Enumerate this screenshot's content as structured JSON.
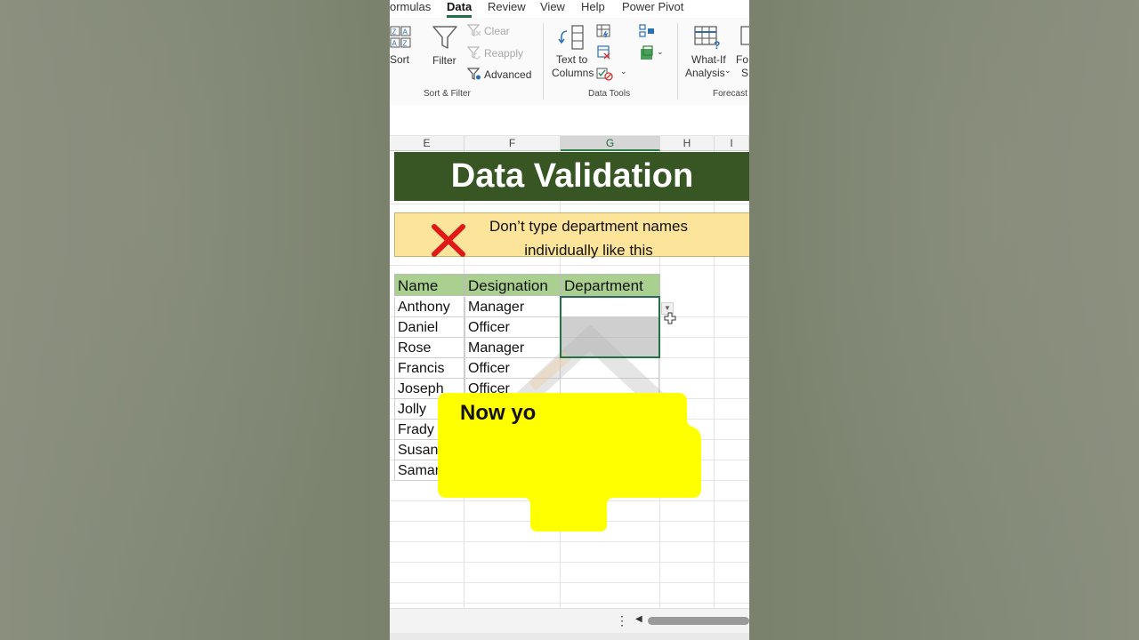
{
  "ribbon": {
    "tabs": [
      {
        "label": "ormulas"
      },
      {
        "label": "Data"
      },
      {
        "label": "Review"
      },
      {
        "label": "View"
      },
      {
        "label": "Help"
      },
      {
        "label": "Power Pivot"
      }
    ],
    "sort_filter": {
      "sort_label": "Sort",
      "filter_label": "Filter",
      "clear_label": "Clear",
      "reapply_label": "Reapply",
      "advanced_label": "Advanced",
      "group_label": "Sort & Filter"
    },
    "data_tools": {
      "text_to_columns_line1": "Text to",
      "text_to_columns_line2": "Columns",
      "group_label": "Data Tools"
    },
    "forecast": {
      "what_if_line1": "What-If",
      "what_if_line2": "Analysis",
      "forecast_sheet_line1": "Fo",
      "forecast_sheet_line2": "S",
      "group_label": "Forecast"
    }
  },
  "columns": [
    "E",
    "F",
    "G",
    "H",
    "I"
  ],
  "sheet": {
    "title": "Data Validation",
    "warning_line1": "Don’t type department names",
    "warning_line2": "individually like this",
    "table_headers": [
      "Name",
      "Designation",
      "Department"
    ],
    "rows": [
      {
        "name": "Anthony",
        "designation": "Manager"
      },
      {
        "name": "Daniel",
        "designation": "Officer"
      },
      {
        "name": "Rose",
        "designation": "Manager"
      },
      {
        "name": "Francis",
        "designation": "Officer"
      },
      {
        "name": "Joseph",
        "designation": "Officer"
      },
      {
        "name": "Jolly",
        "designation": ""
      },
      {
        "name": "Frady",
        "designation": ""
      },
      {
        "name": "Susan",
        "designation": ""
      },
      {
        "name": "Saman",
        "designation": ""
      }
    ]
  },
  "callout": {
    "text": "Now yo"
  },
  "colors": {
    "title_bg": "#375623",
    "warning_bg": "#fce49b",
    "header_bg": "#a9d08e",
    "callout_bg": "#ffff00",
    "excel_green": "#217346",
    "x_mark": "#e01818"
  },
  "icons": [
    "sort-icon",
    "filter-icon",
    "clear-icon",
    "reapply-icon",
    "advanced-filter-icon",
    "text-to-columns-icon",
    "flash-fill-icon",
    "remove-duplicates-icon",
    "data-validation-icon",
    "consolidate-icon",
    "relationships-icon",
    "what-if-analysis-icon",
    "forecast-sheet-icon",
    "red-x-icon",
    "dropdown-arrow-icon",
    "cell-cursor-icon"
  ]
}
